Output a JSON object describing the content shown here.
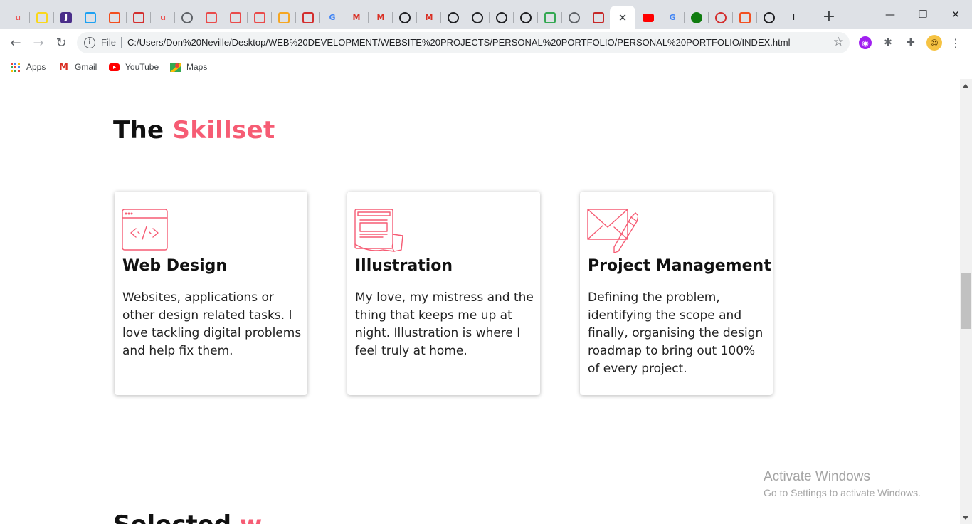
{
  "browser": {
    "tabs": [
      {
        "icon": "udemy-icon",
        "glyph": "u",
        "color": "#ec5252",
        "bg": "#dee1e6"
      },
      {
        "icon": "extension-icon",
        "glyph": "",
        "color": "#f9d71c",
        "bg": "#dee1e6"
      },
      {
        "icon": "hexagon-j-icon",
        "glyph": "J",
        "color": "#fff",
        "bg": "#4a2e8a"
      },
      {
        "icon": "twitter-icon",
        "glyph": "",
        "color": "#1da1f2",
        "bg": "#dee1e6"
      },
      {
        "icon": "figma-icon",
        "glyph": "",
        "color": "#f24e1e",
        "bg": "#dee1e6"
      },
      {
        "icon": "red-square-icon",
        "glyph": "",
        "color": "#d32f2f",
        "bg": "#dee1e6"
      },
      {
        "icon": "udemy-icon",
        "glyph": "u",
        "color": "#ec5252",
        "bg": "#dee1e6"
      },
      {
        "icon": "globe-icon",
        "glyph": "",
        "color": "#5f6368",
        "bg": "#dee1e6"
      },
      {
        "icon": "pen-red-icon",
        "glyph": "",
        "color": "#e94b4b",
        "bg": "#dee1e6"
      },
      {
        "icon": "pen-red-icon",
        "glyph": "",
        "color": "#e94b4b",
        "bg": "#dee1e6"
      },
      {
        "icon": "pen-red-icon",
        "glyph": "",
        "color": "#e94b4b",
        "bg": "#dee1e6"
      },
      {
        "icon": "rainbow-icon",
        "glyph": "",
        "color": "#f5a623",
        "bg": "#dee1e6"
      },
      {
        "icon": "red-square-icon",
        "glyph": "",
        "color": "#d32f2f",
        "bg": "#dee1e6"
      },
      {
        "icon": "google-icon",
        "glyph": "G",
        "color": "#4285f4",
        "bg": "#dee1e6"
      },
      {
        "icon": "gmail-icon",
        "glyph": "M",
        "color": "#d93025",
        "bg": "#dee1e6"
      },
      {
        "icon": "gmail-icon",
        "glyph": "M",
        "color": "#d93025",
        "bg": "#dee1e6"
      },
      {
        "icon": "github-icon",
        "glyph": "",
        "color": "#202124",
        "bg": "#dee1e6"
      },
      {
        "icon": "gmail-icon",
        "glyph": "M",
        "color": "#d93025",
        "bg": "#dee1e6"
      },
      {
        "icon": "mailchimp-icon",
        "glyph": "",
        "color": "#202124",
        "bg": "#dee1e6"
      },
      {
        "icon": "mailchimp-icon",
        "glyph": "",
        "color": "#202124",
        "bg": "#dee1e6"
      },
      {
        "icon": "mailchimp-icon",
        "glyph": "",
        "color": "#202124",
        "bg": "#dee1e6"
      },
      {
        "icon": "mailchimp-icon",
        "glyph": "",
        "color": "#202124",
        "bg": "#dee1e6"
      },
      {
        "icon": "diamond-green-icon",
        "glyph": "",
        "color": "#34a853",
        "bg": "#dee1e6"
      },
      {
        "icon": "globe-icon",
        "glyph": "",
        "color": "#5f6368",
        "bg": "#dee1e6"
      },
      {
        "icon": "shield-red-icon",
        "glyph": "",
        "color": "#c62828",
        "bg": "#dee1e6"
      }
    ],
    "active_tab_close": "✕",
    "tabs_after": [
      {
        "icon": "youtube-icon",
        "glyph": "",
        "color": "#ff0000",
        "bg": "#dee1e6"
      },
      {
        "icon": "google-icon",
        "glyph": "G",
        "color": "#4285f4",
        "bg": "#dee1e6"
      },
      {
        "icon": "xbox-icon",
        "glyph": "",
        "color": "#107c10",
        "bg": "#dee1e6"
      },
      {
        "icon": "record-icon",
        "glyph": "",
        "color": "#d32f2f",
        "bg": "#dee1e6"
      },
      {
        "icon": "microsoft-icon",
        "glyph": "",
        "color": "#f25022",
        "bg": "#dee1e6"
      },
      {
        "icon": "github-icon",
        "glyph": "",
        "color": "#202124",
        "bg": "#dee1e6"
      },
      {
        "icon": "text-cursor-icon",
        "glyph": "I",
        "color": "#202124",
        "bg": "#ffffff"
      }
    ],
    "new_tab": "+",
    "window_controls": {
      "minimize": "—",
      "restore": "❐",
      "close": "✕"
    },
    "omnibox": {
      "scheme": "File",
      "url": "C:/Users/Don%20Neville/Desktop/WEB%20DEVELOPMENT/WEBSITE%20PROJECTS/PERSONAL%20PORTFOLIO/PERSONAL%20PORTFOLIO/INDEX.html"
    },
    "bookmarks": [
      {
        "label": "Apps",
        "icon": "apps-grid-icon"
      },
      {
        "label": "Gmail",
        "icon": "gmail-icon"
      },
      {
        "label": "YouTube",
        "icon": "youtube-icon"
      },
      {
        "label": "Maps",
        "icon": "maps-icon"
      }
    ]
  },
  "page": {
    "section_title_plain": "The",
    "section_title_accent": "Skillset",
    "accent_color": "#f65c74",
    "cards": [
      {
        "icon": "code-window-icon",
        "title": "Web Design",
        "body": "Websites, applications or other design related tasks. I love tackling digital problems and help fix them."
      },
      {
        "icon": "notebook-illustration-icon",
        "title": "Illustration",
        "body": "My love, my mistress and the thing that keeps me up at night. Illustration is where I feel truly at home."
      },
      {
        "icon": "envelope-pen-icon",
        "title": "Project Management",
        "body": "Defining the problem, identifying the scope and finally, organising the design roadmap to bring out 100% of every project."
      }
    ],
    "next_section_plain": "Selected",
    "next_section_accent": "w"
  },
  "watermark": {
    "line1": "Activate Windows",
    "line2": "Go to Settings to activate Windows."
  }
}
